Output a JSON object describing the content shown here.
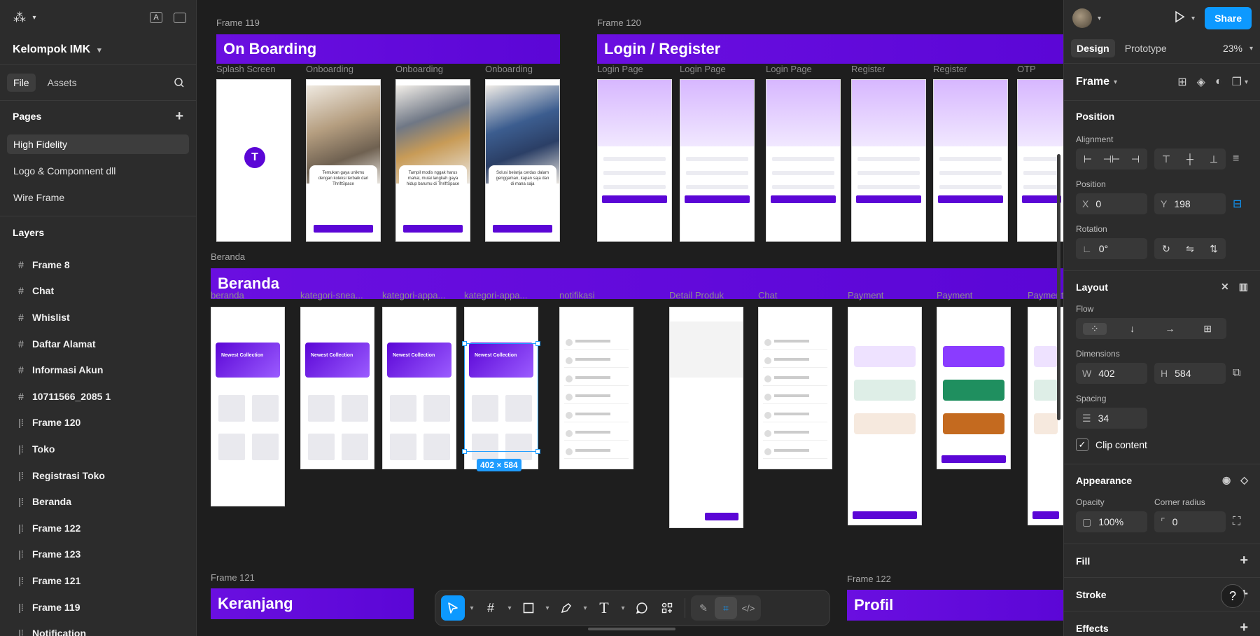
{
  "project": {
    "name": "Kelompok IMK"
  },
  "left_tabs": {
    "file": "File",
    "assets": "Assets"
  },
  "pages": {
    "title": "Pages",
    "items": [
      "High Fidelity",
      "Logo & Componnent dll",
      "Wire Frame"
    ]
  },
  "layers": {
    "title": "Layers",
    "items": [
      {
        "name": "Frame 8",
        "icon": "#"
      },
      {
        "name": "Chat",
        "icon": "#"
      },
      {
        "name": "Whislist",
        "icon": "#"
      },
      {
        "name": "Daftar Alamat",
        "icon": "#"
      },
      {
        "name": "Informasi Akun",
        "icon": "#"
      },
      {
        "name": "10711566_2085 1",
        "icon": "#"
      },
      {
        "name": "Frame 120",
        "icon": "|⁞"
      },
      {
        "name": "Toko",
        "icon": "|⁞"
      },
      {
        "name": "Registrasi Toko",
        "icon": "|⁞"
      },
      {
        "name": "Beranda",
        "icon": "|⁞"
      },
      {
        "name": "Frame 122",
        "icon": "|⁞"
      },
      {
        "name": "Frame 123",
        "icon": "|⁞"
      },
      {
        "name": "Frame 121",
        "icon": "|⁞"
      },
      {
        "name": "Frame 119",
        "icon": "|⁞"
      },
      {
        "name": "Notification",
        "icon": "|⁞"
      }
    ]
  },
  "canvas": {
    "frame119": {
      "label": "Frame 119",
      "title": "On Boarding",
      "screens": [
        "Splash Screen",
        "Onboarding",
        "Onboarding",
        "Onboarding"
      ]
    },
    "frame120": {
      "label": "Frame 120",
      "title": "Login / Register",
      "screens": [
        "Login Page",
        "Login Page",
        "Login Page",
        "Register",
        "Register",
        "OTP"
      ]
    },
    "beranda": {
      "label": "Beranda",
      "title": "Beranda",
      "screens": [
        "beranda",
        "kategori-snea...",
        "kategori-appa...",
        "kategori-appa...",
        "notifikasi",
        "Detail Produk",
        "Chat",
        "Payment",
        "Payment",
        "Payment"
      ]
    },
    "frame121": {
      "label": "Frame 121",
      "title": "Keranjang"
    },
    "frame122": {
      "label": "Frame 122",
      "title": "Profil"
    },
    "selection_size": "402 × 584",
    "onboarding_texts": [
      "Temukan gaya unikmu dengan koleksi terbaik dari ThriftSpace",
      "Tampil modis nggak harus mahal, mulai langkah gaya hidup barumu di ThriftSpace",
      "Solusi belanja cerdas dalam genggaman, kapan saja dan di mana saja"
    ],
    "banner_text": "Newest Collection"
  },
  "toolbar": {
    "tools": [
      "move-tool",
      "frame-tool",
      "shape-tool",
      "pen-tool",
      "text-tool",
      "comment-tool",
      "actions-tool"
    ],
    "modes": [
      "draw-mode",
      "design-mode",
      "dev-mode"
    ]
  },
  "right": {
    "share": "Share",
    "tabs": {
      "design": "Design",
      "prototype": "Prototype"
    },
    "zoom": "23%",
    "frame_type": "Frame",
    "position": {
      "title": "Position",
      "alignment_label": "Alignment",
      "position_label": "Position",
      "x_key": "X",
      "x": "0",
      "y_key": "Y",
      "y": "198",
      "rotation_label": "Rotation",
      "rotation": "0°"
    },
    "layout": {
      "title": "Layout",
      "flow_label": "Flow",
      "dimensions_label": "Dimensions",
      "w_key": "W",
      "w": "402",
      "h_key": "H",
      "h": "584",
      "spacing_label": "Spacing",
      "spacing": "34",
      "clip_label": "Clip content"
    },
    "appearance": {
      "title": "Appearance",
      "opacity_label": "Opacity",
      "opacity": "100%",
      "radius_label": "Corner radius",
      "radius": "0"
    },
    "fill": "Fill",
    "stroke": "Stroke",
    "effects": "Effects",
    "help": "?"
  },
  "colors": {
    "accent": "#0d99ff",
    "brand_purple": "#5b06d6",
    "panel": "#2c2c2c",
    "canvas": "#1e1e1e"
  }
}
